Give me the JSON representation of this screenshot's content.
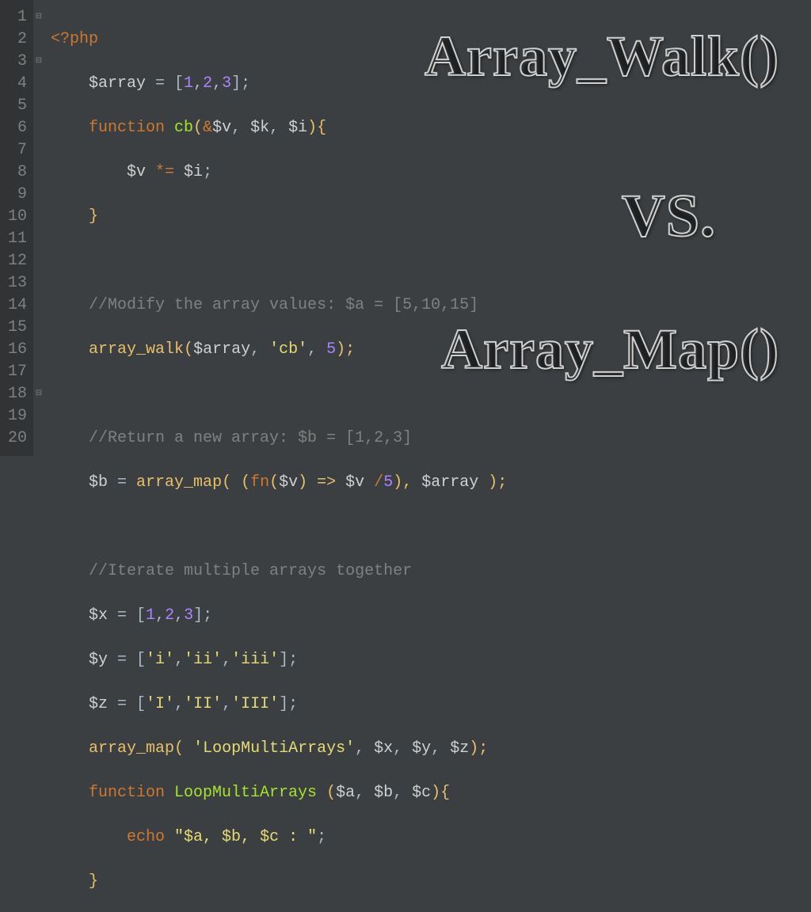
{
  "overlay": {
    "title1": "Array_Walk()",
    "title2": "VS.",
    "title3": "Array_Map()"
  },
  "gutter": {
    "lines": [
      "1",
      "2",
      "3",
      "4",
      "5",
      "6",
      "7",
      "8",
      "9",
      "10",
      "11",
      "12",
      "13",
      "14",
      "15",
      "16",
      "17",
      "18",
      "19",
      "20"
    ]
  },
  "fold": {
    "marks": [
      "⊟",
      "",
      "⊟",
      "",
      "",
      "",
      "",
      "",
      "",
      "",
      "",
      "",
      "",
      "",
      "",
      "",
      "",
      "⊟",
      "",
      ""
    ]
  },
  "code": {
    "l1": {
      "a": "<?php"
    },
    "l2": {
      "a": "$array",
      "b": " = [",
      "c": "1",
      "d": ",",
      "e": "2",
      "f": ",",
      "g": "3",
      "h": "];"
    },
    "l3": {
      "a": "function",
      "b": " cb",
      "c": "(",
      "d": "&",
      "e": "$v",
      "f": ", ",
      "g": "$k",
      "h": ", ",
      "i": "$i",
      "j": "){"
    },
    "l4": {
      "a": "$v",
      "b": " *= ",
      "c": "$i",
      "d": ";"
    },
    "l5": {
      "a": "}"
    },
    "l7": {
      "a": "//Modify the array values: $a = [5,10,15]"
    },
    "l8": {
      "a": "array_walk",
      "b": "(",
      "c": "$array",
      "d": ", ",
      "e": "'cb'",
      "f": ", ",
      "g": "5",
      "h": ");"
    },
    "l10": {
      "a": "//Return a new array: $b = [1,2,3]"
    },
    "l11": {
      "a": "$b",
      "b": " = ",
      "c": "array_map",
      "d": "( (",
      "e": "fn",
      "f": "(",
      "g": "$v",
      "h": ") => ",
      "i": "$v",
      "j": " /",
      "k": "5",
      "l": "), ",
      "m": "$array",
      "n": " );"
    },
    "l13": {
      "a": "//Iterate multiple arrays together"
    },
    "l14": {
      "a": "$x",
      "b": " = [",
      "c": "1",
      "d": ",",
      "e": "2",
      "f": ",",
      "g": "3",
      "h": "];"
    },
    "l15": {
      "a": "$y",
      "b": " = [",
      "c": "'i'",
      "d": ",",
      "e": "'ii'",
      "f": ",",
      "g": "'iii'",
      "h": "];"
    },
    "l16": {
      "a": "$z",
      "b": " = [",
      "c": "'I'",
      "d": ",",
      "e": "'II'",
      "f": ",",
      "g": "'III'",
      "h": "];"
    },
    "l17": {
      "a": "array_map",
      "b": "( ",
      "c": "'LoopMultiArrays'",
      "d": ", ",
      "e": "$x",
      "f": ", ",
      "g": "$y",
      "h": ", ",
      "i": "$z",
      "j": ");"
    },
    "l18": {
      "a": "function",
      "b": " LoopMultiArrays ",
      "c": "(",
      "d": "$a",
      "e": ", ",
      "f": "$b",
      "g": ", ",
      "h": "$c",
      "i": "){"
    },
    "l19": {
      "a": "echo",
      "b": " ",
      "c": "\"$a, $b, $c : \"",
      "d": ";"
    },
    "l20": {
      "a": "}"
    }
  }
}
